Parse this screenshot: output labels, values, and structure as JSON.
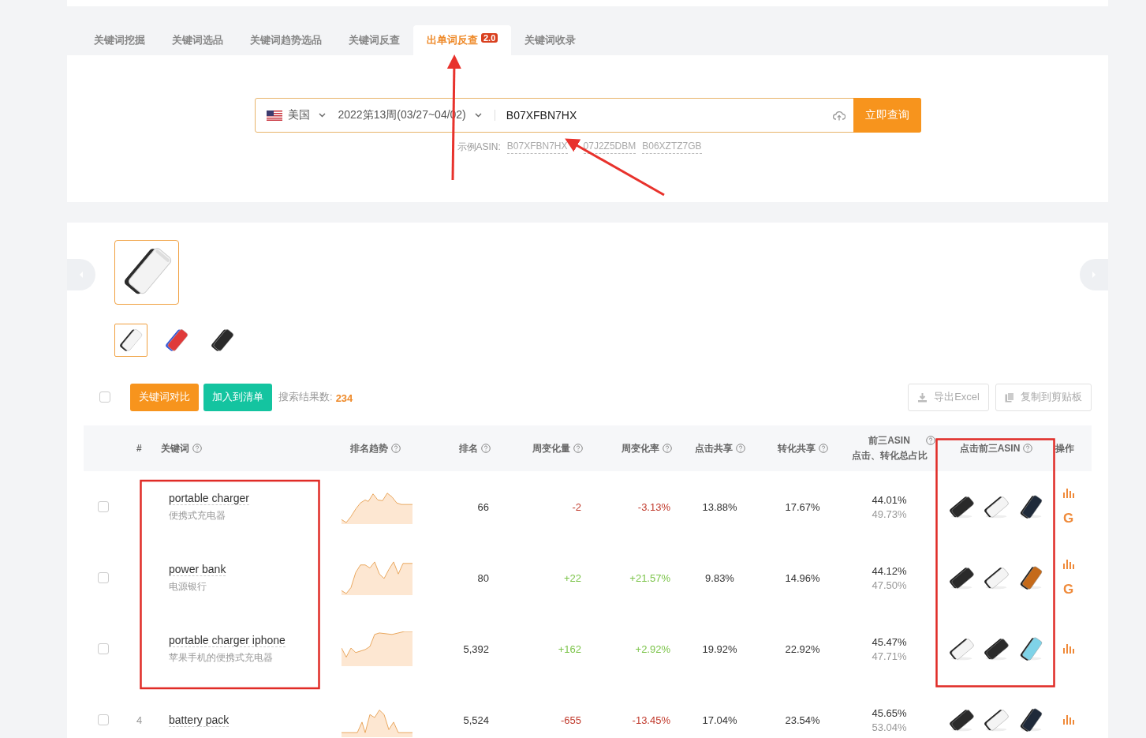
{
  "tabs": [
    {
      "label": "关键词挖掘",
      "selected": false
    },
    {
      "label": "关键词选品",
      "selected": false
    },
    {
      "label": "关键词趋势选品",
      "selected": false
    },
    {
      "label": "关键词反查",
      "selected": false
    },
    {
      "label": "出单词反查",
      "selected": true,
      "badge": "2.0"
    },
    {
      "label": "关键词收录",
      "selected": false
    }
  ],
  "search": {
    "country": "美国",
    "week": "2022第13周(03/27~04/02)",
    "value": "B07XFBN7HX",
    "button": "立即查询",
    "examples_label": "示例ASIN:",
    "examples": [
      "B07XFBN7HX",
      "07J2Z5DBM",
      "B06XZTZ7GB"
    ]
  },
  "product": {
    "main_image": {
      "kind": "picture"
    },
    "thumbnails": [
      {
        "kind": "picture",
        "selected": true
      },
      {
        "kind": "picture",
        "selected": false
      },
      {
        "kind": "picture",
        "selected": false
      }
    ]
  },
  "toolbar": {
    "select_all": {
      "checked": false
    },
    "compare_button": "关键词对比",
    "add_button": "加入到清单",
    "result_label": "搜索结果数:",
    "result_count": "234",
    "export_button": "导出Excel",
    "copy_button": "复制到剪贴板"
  },
  "table": {
    "columns": [
      "#",
      "关键词",
      "排名趋势",
      "排名",
      "周变化量",
      "周变化率",
      "点击共享",
      "转化共享",
      "前三ASIN\n点击、转化总占比",
      "点击前三ASIN",
      "操作"
    ],
    "rows": [
      {
        "checked": false,
        "keyword": "portable charger",
        "translation": "便携式充电器",
        "rank": "66",
        "change": "-2",
        "change_rate": "-3.13%",
        "color": "#c0392b",
        "click_share": "13.88%",
        "conversion_share": "17.67%",
        "top3_click": "44.01%",
        "top3_conversion": "49.73%",
        "top3_asins": [
          {
            "kind": "picture"
          },
          {
            "kind": "picture"
          },
          {
            "kind": "picture"
          }
        ],
        "google": "G"
      },
      {
        "checked": false,
        "keyword": "power bank",
        "translation": "电源银行",
        "rank": "80",
        "change": "+22",
        "change_rate": "+21.57%",
        "color": "#7cc44a",
        "click_share": "9.83%",
        "conversion_share": "14.96%",
        "top3_click": "44.12%",
        "top3_conversion": "47.50%",
        "top3_asins": [
          {
            "kind": "picture"
          },
          {
            "kind": "picture"
          },
          {
            "kind": "picture"
          }
        ],
        "google": "G"
      },
      {
        "checked": false,
        "keyword": "portable charger iphone",
        "translation": "苹果手机的便携式充电器",
        "rank": "5,392",
        "change": "+162",
        "change_rate": "+2.92%",
        "color": "#7cc44a",
        "click_share": "19.92%",
        "conversion_share": "22.92%",
        "top3_click": "45.47%",
        "top3_conversion": "47.71%",
        "top3_asins": [
          {
            "kind": "picture"
          },
          {
            "kind": "picture"
          },
          {
            "kind": "picture"
          }
        ]
      },
      {
        "checked": false,
        "index": "4",
        "keyword": "battery pack",
        "rank": "5,524",
        "change": "-655",
        "change_rate": "-13.45%",
        "color": "#c0392b",
        "click_share": "17.04%",
        "conversion_share": "23.54%",
        "top3_click": "45.65%",
        "top3_conversion": "53.04%",
        "top3_asins": [
          {
            "kind": "picture"
          },
          {
            "kind": "picture"
          },
          {
            "kind": "picture"
          }
        ]
      }
    ]
  }
}
